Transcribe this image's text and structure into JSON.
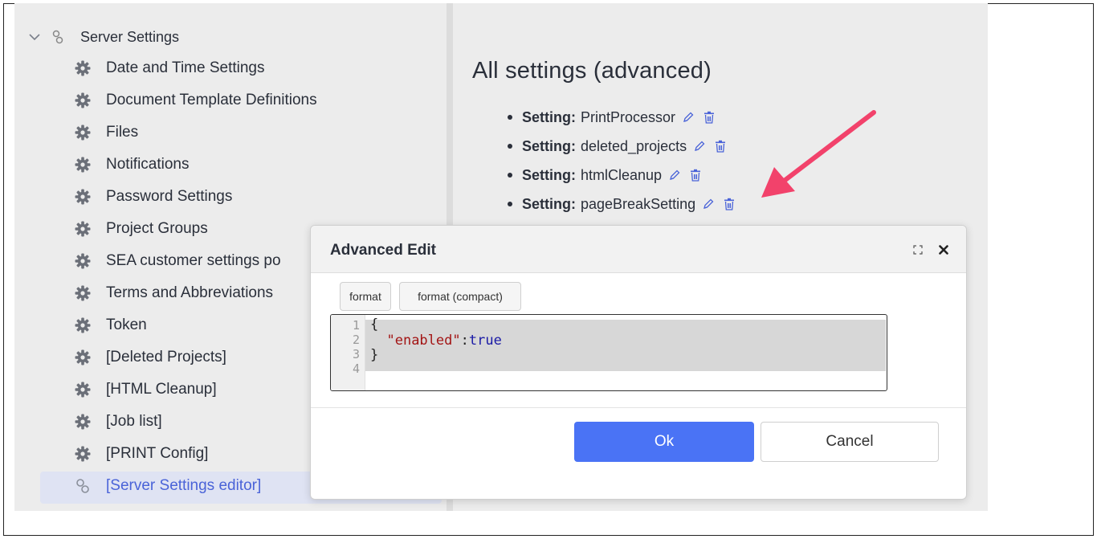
{
  "tree": {
    "root_label": "Server Settings",
    "items": [
      {
        "label": "Date and Time Settings"
      },
      {
        "label": "Document Template Definitions"
      },
      {
        "label": "Files"
      },
      {
        "label": "Notifications"
      },
      {
        "label": "Password Settings"
      },
      {
        "label": "Project Groups"
      },
      {
        "label": "SEA customer settings po"
      },
      {
        "label": "Terms and Abbreviations"
      },
      {
        "label": "Token"
      },
      {
        "label": "[Deleted Projects]"
      },
      {
        "label": "[HTML Cleanup]"
      },
      {
        "label": "[Job list]"
      },
      {
        "label": "[PRINT Config]"
      },
      {
        "label": "[Server Settings editor]"
      }
    ],
    "selected_item": "[Server Settings editor]"
  },
  "content": {
    "heading": "All settings (advanced)",
    "setting_prefix": "Setting:",
    "settings": [
      {
        "name": "PrintProcessor"
      },
      {
        "name": "deleted_projects"
      },
      {
        "name": "htmlCleanup"
      },
      {
        "name": "pageBreakSetting"
      }
    ]
  },
  "modal": {
    "title": "Advanced Edit",
    "format_button": "format",
    "format_compact_button": "format (compact)",
    "line_numbers": [
      "1",
      "2",
      "3",
      "4"
    ],
    "code": {
      "open_brace": "{",
      "key": "\"enabled\"",
      "colon": ":",
      "value": "true",
      "close_brace": "}"
    },
    "ok_label": "Ok",
    "cancel_label": "Cancel"
  },
  "colors": {
    "accent": "#4a73f5",
    "annotation_arrow": "#f2426b",
    "selected_text": "#4a63d8"
  }
}
